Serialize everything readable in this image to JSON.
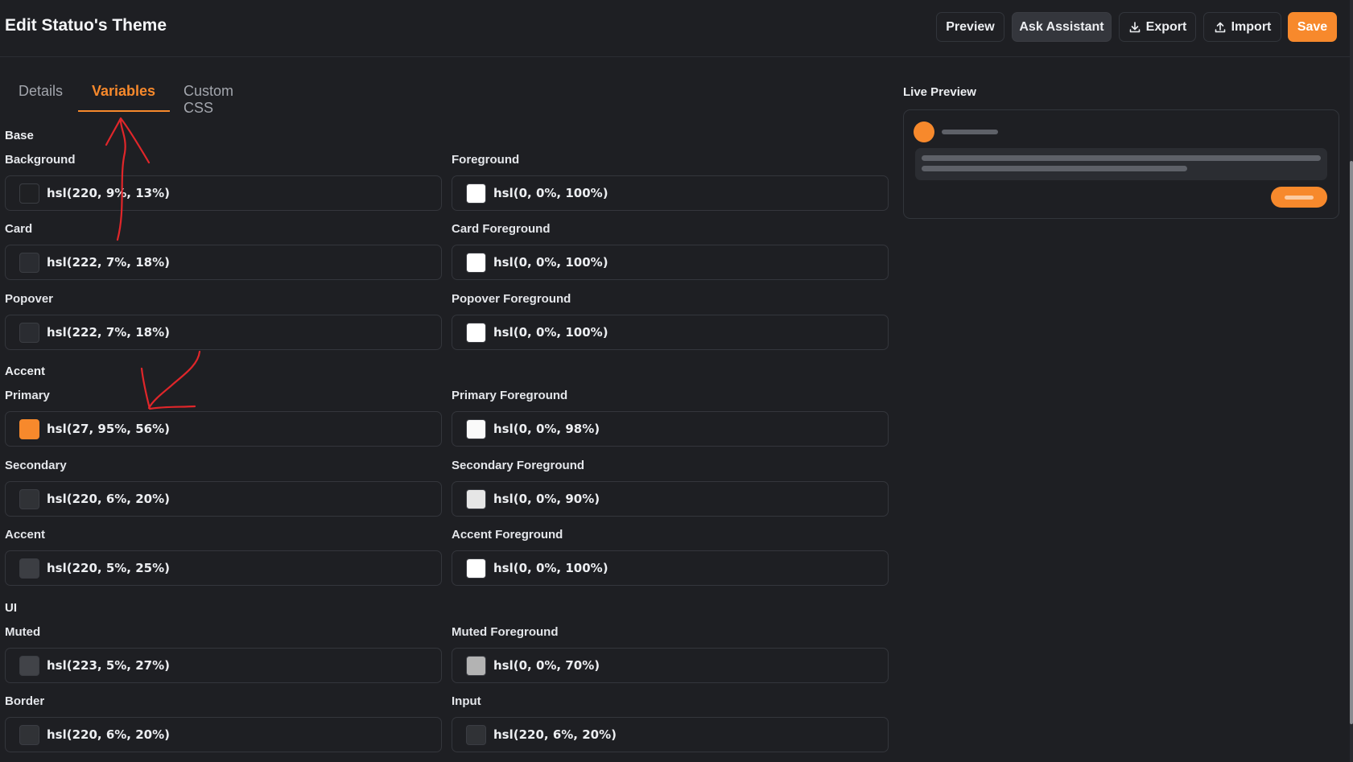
{
  "header": {
    "title": "Edit Statuo's Theme",
    "buttons": {
      "preview": "Preview",
      "ask_assistant": "Ask Assistant",
      "export": "Export",
      "import": "Import",
      "save": "Save"
    }
  },
  "tabs": [
    "Details",
    "Variables",
    "Custom CSS"
  ],
  "active_tab": "Variables",
  "sections": {
    "base": "Base",
    "accent": "Accent",
    "ui": "UI"
  },
  "fields": {
    "background": {
      "label": "Background",
      "value": "hsl(220, 9%, 13%)",
      "color": "#1f2023"
    },
    "foreground": {
      "label": "Foreground",
      "value": "hsl(0, 0%, 100%)",
      "color": "#ffffff"
    },
    "card": {
      "label": "Card",
      "value": "hsl(222, 7%, 18%)",
      "color": "#2a2c31"
    },
    "card_foreground": {
      "label": "Card Foreground",
      "value": "hsl(0, 0%, 100%)",
      "color": "#ffffff"
    },
    "popover": {
      "label": "Popover",
      "value": "hsl(222, 7%, 18%)",
      "color": "#2a2c31"
    },
    "popover_foreground": {
      "label": "Popover Foreground",
      "value": "hsl(0, 0%, 100%)",
      "color": "#ffffff"
    },
    "primary": {
      "label": "Primary",
      "value": "hsl(27, 95%, 56%)",
      "color": "#f7892c"
    },
    "primary_foreground": {
      "label": "Primary Foreground",
      "value": "hsl(0, 0%, 98%)",
      "color": "#fafafa"
    },
    "secondary": {
      "label": "Secondary",
      "value": "hsl(220, 6%, 20%)",
      "color": "#303236"
    },
    "secondary_foreground": {
      "label": "Secondary Foreground",
      "value": "hsl(0, 0%, 90%)",
      "color": "#e6e6e6"
    },
    "accent": {
      "label": "Accent",
      "value": "hsl(220, 5%, 25%)",
      "color": "#3c3e43"
    },
    "accent_foreground": {
      "label": "Accent Foreground",
      "value": "hsl(0, 0%, 100%)",
      "color": "#ffffff"
    },
    "muted": {
      "label": "Muted",
      "value": "hsl(223, 5%, 27%)",
      "color": "#414348"
    },
    "muted_foreground": {
      "label": "Muted Foreground",
      "value": "hsl(0, 0%, 70%)",
      "color": "#b3b3b3"
    },
    "border": {
      "label": "Border",
      "value": "hsl(220, 6%, 20%)",
      "color": "#303236"
    },
    "input": {
      "label": "Input",
      "value": "hsl(220, 6%, 20%)",
      "color": "#303236"
    }
  },
  "live_preview": {
    "title": "Live Preview"
  },
  "colors": {
    "accent": "#f7892c",
    "annotation": "#e0262a"
  },
  "icons": {
    "export": "download-icon",
    "import": "upload-icon"
  }
}
